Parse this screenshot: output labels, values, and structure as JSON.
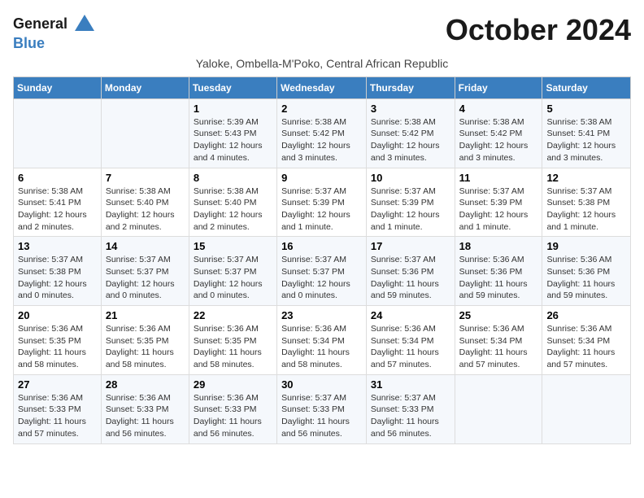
{
  "header": {
    "logo_line1": "General",
    "logo_line2": "Blue",
    "month_title": "October 2024",
    "subtitle": "Yaloke, Ombella-M'Poko, Central African Republic"
  },
  "days_of_week": [
    "Sunday",
    "Monday",
    "Tuesday",
    "Wednesday",
    "Thursday",
    "Friday",
    "Saturday"
  ],
  "weeks": [
    [
      {
        "day": "",
        "info": ""
      },
      {
        "day": "",
        "info": ""
      },
      {
        "day": "1",
        "info": "Sunrise: 5:39 AM\nSunset: 5:43 PM\nDaylight: 12 hours and 4 minutes."
      },
      {
        "day": "2",
        "info": "Sunrise: 5:38 AM\nSunset: 5:42 PM\nDaylight: 12 hours and 3 minutes."
      },
      {
        "day": "3",
        "info": "Sunrise: 5:38 AM\nSunset: 5:42 PM\nDaylight: 12 hours and 3 minutes."
      },
      {
        "day": "4",
        "info": "Sunrise: 5:38 AM\nSunset: 5:42 PM\nDaylight: 12 hours and 3 minutes."
      },
      {
        "day": "5",
        "info": "Sunrise: 5:38 AM\nSunset: 5:41 PM\nDaylight: 12 hours and 3 minutes."
      }
    ],
    [
      {
        "day": "6",
        "info": "Sunrise: 5:38 AM\nSunset: 5:41 PM\nDaylight: 12 hours and 2 minutes."
      },
      {
        "day": "7",
        "info": "Sunrise: 5:38 AM\nSunset: 5:40 PM\nDaylight: 12 hours and 2 minutes."
      },
      {
        "day": "8",
        "info": "Sunrise: 5:38 AM\nSunset: 5:40 PM\nDaylight: 12 hours and 2 minutes."
      },
      {
        "day": "9",
        "info": "Sunrise: 5:37 AM\nSunset: 5:39 PM\nDaylight: 12 hours and 1 minute."
      },
      {
        "day": "10",
        "info": "Sunrise: 5:37 AM\nSunset: 5:39 PM\nDaylight: 12 hours and 1 minute."
      },
      {
        "day": "11",
        "info": "Sunrise: 5:37 AM\nSunset: 5:39 PM\nDaylight: 12 hours and 1 minute."
      },
      {
        "day": "12",
        "info": "Sunrise: 5:37 AM\nSunset: 5:38 PM\nDaylight: 12 hours and 1 minute."
      }
    ],
    [
      {
        "day": "13",
        "info": "Sunrise: 5:37 AM\nSunset: 5:38 PM\nDaylight: 12 hours and 0 minutes."
      },
      {
        "day": "14",
        "info": "Sunrise: 5:37 AM\nSunset: 5:37 PM\nDaylight: 12 hours and 0 minutes."
      },
      {
        "day": "15",
        "info": "Sunrise: 5:37 AM\nSunset: 5:37 PM\nDaylight: 12 hours and 0 minutes."
      },
      {
        "day": "16",
        "info": "Sunrise: 5:37 AM\nSunset: 5:37 PM\nDaylight: 12 hours and 0 minutes."
      },
      {
        "day": "17",
        "info": "Sunrise: 5:37 AM\nSunset: 5:36 PM\nDaylight: 11 hours and 59 minutes."
      },
      {
        "day": "18",
        "info": "Sunrise: 5:36 AM\nSunset: 5:36 PM\nDaylight: 11 hours and 59 minutes."
      },
      {
        "day": "19",
        "info": "Sunrise: 5:36 AM\nSunset: 5:36 PM\nDaylight: 11 hours and 59 minutes."
      }
    ],
    [
      {
        "day": "20",
        "info": "Sunrise: 5:36 AM\nSunset: 5:35 PM\nDaylight: 11 hours and 58 minutes."
      },
      {
        "day": "21",
        "info": "Sunrise: 5:36 AM\nSunset: 5:35 PM\nDaylight: 11 hours and 58 minutes."
      },
      {
        "day": "22",
        "info": "Sunrise: 5:36 AM\nSunset: 5:35 PM\nDaylight: 11 hours and 58 minutes."
      },
      {
        "day": "23",
        "info": "Sunrise: 5:36 AM\nSunset: 5:34 PM\nDaylight: 11 hours and 58 minutes."
      },
      {
        "day": "24",
        "info": "Sunrise: 5:36 AM\nSunset: 5:34 PM\nDaylight: 11 hours and 57 minutes."
      },
      {
        "day": "25",
        "info": "Sunrise: 5:36 AM\nSunset: 5:34 PM\nDaylight: 11 hours and 57 minutes."
      },
      {
        "day": "26",
        "info": "Sunrise: 5:36 AM\nSunset: 5:34 PM\nDaylight: 11 hours and 57 minutes."
      }
    ],
    [
      {
        "day": "27",
        "info": "Sunrise: 5:36 AM\nSunset: 5:33 PM\nDaylight: 11 hours and 57 minutes."
      },
      {
        "day": "28",
        "info": "Sunrise: 5:36 AM\nSunset: 5:33 PM\nDaylight: 11 hours and 56 minutes."
      },
      {
        "day": "29",
        "info": "Sunrise: 5:36 AM\nSunset: 5:33 PM\nDaylight: 11 hours and 56 minutes."
      },
      {
        "day": "30",
        "info": "Sunrise: 5:37 AM\nSunset: 5:33 PM\nDaylight: 11 hours and 56 minutes."
      },
      {
        "day": "31",
        "info": "Sunrise: 5:37 AM\nSunset: 5:33 PM\nDaylight: 11 hours and 56 minutes."
      },
      {
        "day": "",
        "info": ""
      },
      {
        "day": "",
        "info": ""
      }
    ]
  ]
}
